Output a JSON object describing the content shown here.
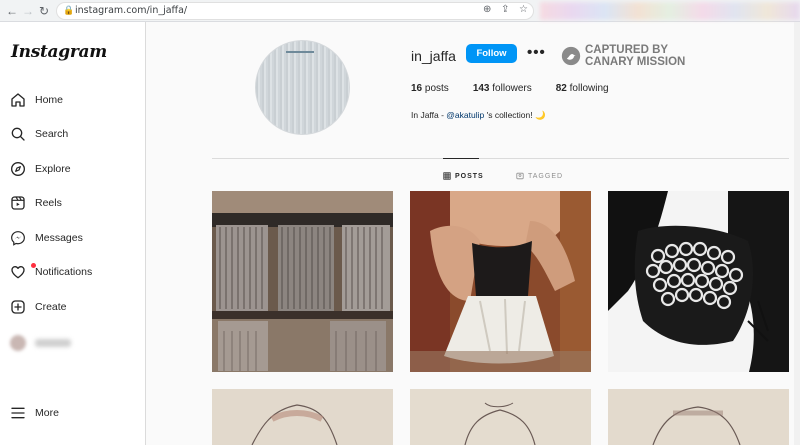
{
  "browser": {
    "url": "instagram.com/in_jaffa/"
  },
  "sidebar": {
    "logo": "Instagram",
    "items": [
      {
        "label": "Home",
        "icon": "home-icon"
      },
      {
        "label": "Search",
        "icon": "search-icon"
      },
      {
        "label": "Explore",
        "icon": "compass-icon"
      },
      {
        "label": "Reels",
        "icon": "reels-icon"
      },
      {
        "label": "Messages",
        "icon": "messenger-icon"
      },
      {
        "label": "Notifications",
        "icon": "heart-icon"
      },
      {
        "label": "Create",
        "icon": "plus-square-icon"
      }
    ],
    "more_label": "More"
  },
  "profile": {
    "username": "in_jaffa",
    "follow_label": "Follow",
    "more_dots": "•••",
    "posts_count": "16",
    "posts_label": "posts",
    "followers_count": "143",
    "followers_label": "followers",
    "following_count": "82",
    "following_label": "following",
    "bio_prefix": "In Jaffa - ",
    "bio_mention": "@akatulip",
    "bio_suffix": " 's collection! 🌙"
  },
  "watermark": {
    "line1": "CAPTURED BY",
    "line2": "CANARY MISSION"
  },
  "tabs": {
    "posts": "POSTS",
    "tagged": "TAGGED"
  },
  "colors": {
    "accent": "#0095f6",
    "border": "#dbdbdb",
    "notification": "#ff3040"
  }
}
